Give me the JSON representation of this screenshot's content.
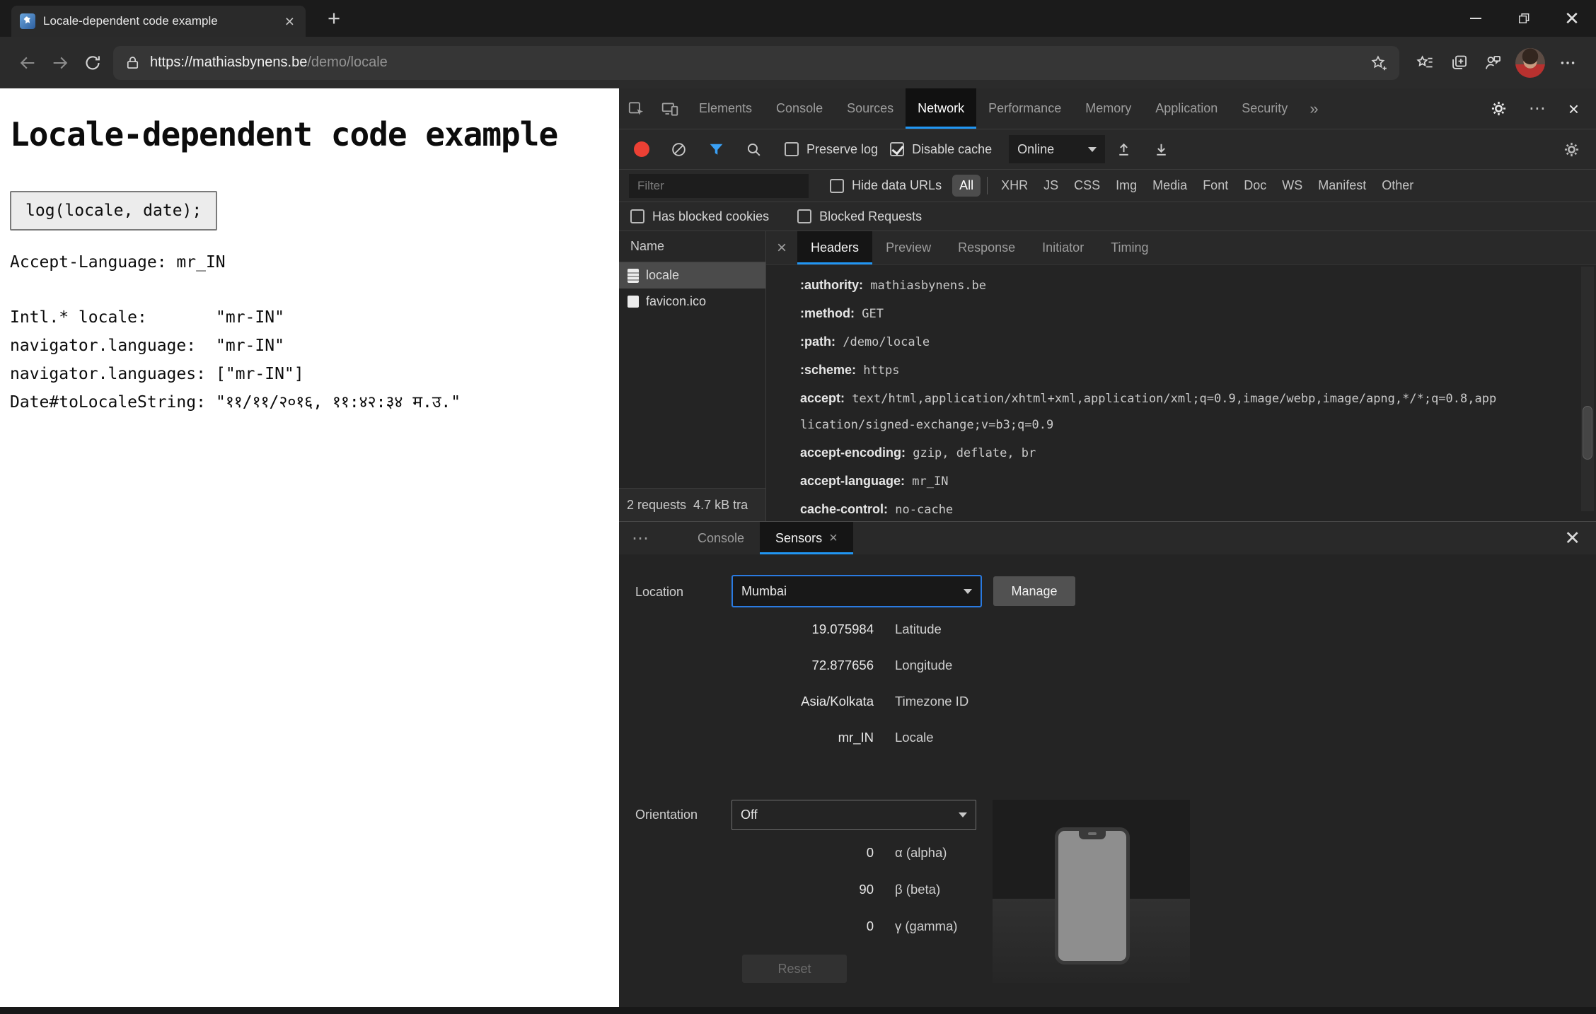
{
  "colors": {
    "accent_blue": "#2196f3",
    "record_red": "#ec4034",
    "selection_gray": "#4b4b4b"
  },
  "browser": {
    "tab": {
      "title": "Locale-dependent code example"
    },
    "url": {
      "host": "https://mathiasbynens.be",
      "path": "/demo/locale"
    }
  },
  "page": {
    "title": "Locale-dependent code example",
    "code_snippet": "log(locale, date);",
    "accept_language": "Accept-Language: mr_IN",
    "locale_rows": [
      {
        "label": "Intl.* locale:",
        "value": "\"mr-IN\""
      },
      {
        "label": "navigator.language:",
        "value": "\"mr-IN\""
      },
      {
        "label": "navigator.languages:",
        "value": "[\"mr-IN\"]"
      },
      {
        "label": "Date#toLocaleString:",
        "value": "\"११/११/२०१६, ११:४२:३४ म.उ.\""
      }
    ]
  },
  "devtools": {
    "main_tabs": [
      "Elements",
      "Console",
      "Sources",
      "Network",
      "Performance",
      "Memory",
      "Application",
      "Security"
    ],
    "active_main_tab": "Network",
    "network_toolbar": {
      "preserve_log": "Preserve log",
      "disable_cache": "Disable cache",
      "throttling": "Online"
    },
    "filter_bar": {
      "placeholder": "Filter",
      "hide_data_urls": "Hide data URLs",
      "types": [
        "All",
        "XHR",
        "JS",
        "CSS",
        "Img",
        "Media",
        "Font",
        "Doc",
        "WS",
        "Manifest",
        "Other"
      ],
      "active_type": "All"
    },
    "blocked_bar": {
      "has_blocked_cookies": "Has blocked cookies",
      "blocked_requests": "Blocked Requests"
    },
    "requests": {
      "name_header": "Name",
      "rows": [
        {
          "name": "locale",
          "icon": "document"
        },
        {
          "name": "favicon.ico",
          "icon": "image"
        }
      ],
      "selected": "locale"
    },
    "detail_tabs": [
      "Headers",
      "Preview",
      "Response",
      "Initiator",
      "Timing"
    ],
    "active_detail_tab": "Headers",
    "headers": [
      {
        "key": ":authority:",
        "value": "mathiasbynens.be"
      },
      {
        "key": ":method:",
        "value": "GET"
      },
      {
        "key": ":path:",
        "value": "/demo/locale"
      },
      {
        "key": ":scheme:",
        "value": "https"
      },
      {
        "key": "accept:",
        "value": "text/html,application/xhtml+xml,application/xml;q=0.9,image/webp,image/apng,*/*;q=0.8,application/signed-exchange;v=b3;q=0.9"
      },
      {
        "key": "accept-encoding:",
        "value": "gzip, deflate, br"
      },
      {
        "key": "accept-language:",
        "value": "mr_IN"
      },
      {
        "key": "cache-control:",
        "value": "no-cache"
      }
    ],
    "summary": "2 requests  4.7 kB tra"
  },
  "drawer": {
    "tabs": [
      "Console",
      "Sensors"
    ],
    "active_tab": "Sensors",
    "sensors": {
      "location_label": "Location",
      "location_value": "Mumbai",
      "manage_button": "Manage",
      "geo_fields": [
        {
          "value": "19.075984",
          "label": "Latitude"
        },
        {
          "value": "72.877656",
          "label": "Longitude"
        },
        {
          "value": "Asia/Kolkata",
          "label": "Timezone ID"
        },
        {
          "value": "mr_IN",
          "label": "Locale"
        }
      ],
      "orientation_label": "Orientation",
      "orientation_value": "Off",
      "orientation_fields": [
        {
          "value": "0",
          "label": "α (alpha)"
        },
        {
          "value": "90",
          "label": "β (beta)"
        },
        {
          "value": "0",
          "label": "γ (gamma)"
        }
      ],
      "reset_button": "Reset"
    }
  }
}
